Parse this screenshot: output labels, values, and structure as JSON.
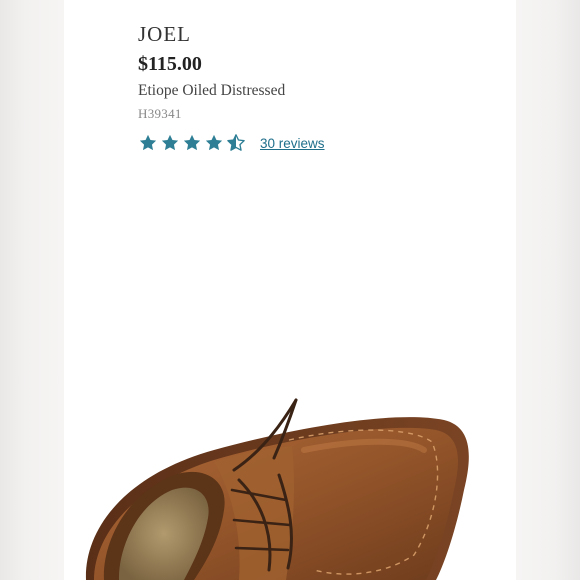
{
  "product": {
    "brand": "JOEL",
    "price": "$115.00",
    "name": "Etiope Oiled Distressed",
    "sku": "H39341"
  },
  "rating": {
    "value": 4.5,
    "max": 5,
    "star_color": "#2e7f95",
    "reviews_label": "30 reviews"
  },
  "colors": {
    "background": "#ffffff",
    "link": "#1f6f8b",
    "leather": "#9a5a2e"
  },
  "image": {
    "subject": "shoe-photo"
  }
}
